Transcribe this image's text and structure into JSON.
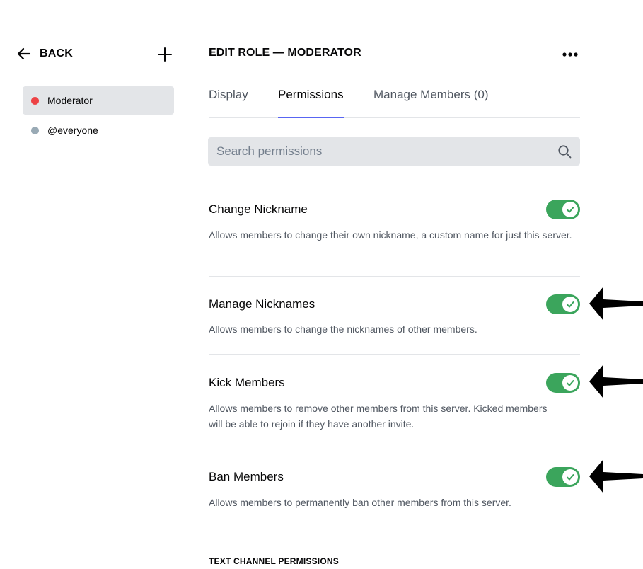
{
  "sidebar": {
    "back_label": "BACK",
    "roles": [
      {
        "name": "Moderator",
        "color": "#ed4245",
        "selected": true
      },
      {
        "name": "@everyone",
        "color": "#99aab5",
        "selected": false
      }
    ]
  },
  "header": {
    "title": "EDIT ROLE — MODERATOR"
  },
  "tabs": [
    {
      "label": "Display",
      "active": false
    },
    {
      "label": "Permissions",
      "active": true
    },
    {
      "label": "Manage Members (0)",
      "active": false
    }
  ],
  "search": {
    "placeholder": "Search permissions",
    "value": ""
  },
  "permissions": [
    {
      "title": "Change Nickname",
      "description": "Allows members to change their own nickname, a custom name for just this server.",
      "enabled": true
    },
    {
      "title": "Manage Nicknames",
      "description": "Allows members to change the nicknames of other members.",
      "enabled": true
    },
    {
      "title": "Kick Members",
      "description": "Allows members to remove other members from this server. Kicked members will be able to rejoin if they have another invite.",
      "enabled": true
    },
    {
      "title": "Ban Members",
      "description": "Allows members to permanently ban other members from this server.",
      "enabled": true
    }
  ],
  "next_section": "TEXT CHANNEL PERMISSIONS",
  "colors": {
    "toggle_on": "#3ba55c",
    "tab_active_underline": "#5865f2",
    "annotation_arrow": "#000000"
  },
  "icons": {
    "back": "arrow-left-icon",
    "add": "plus-icon",
    "more": "more-horizontal-icon",
    "search": "search-icon",
    "toggle_check": "check-icon"
  }
}
